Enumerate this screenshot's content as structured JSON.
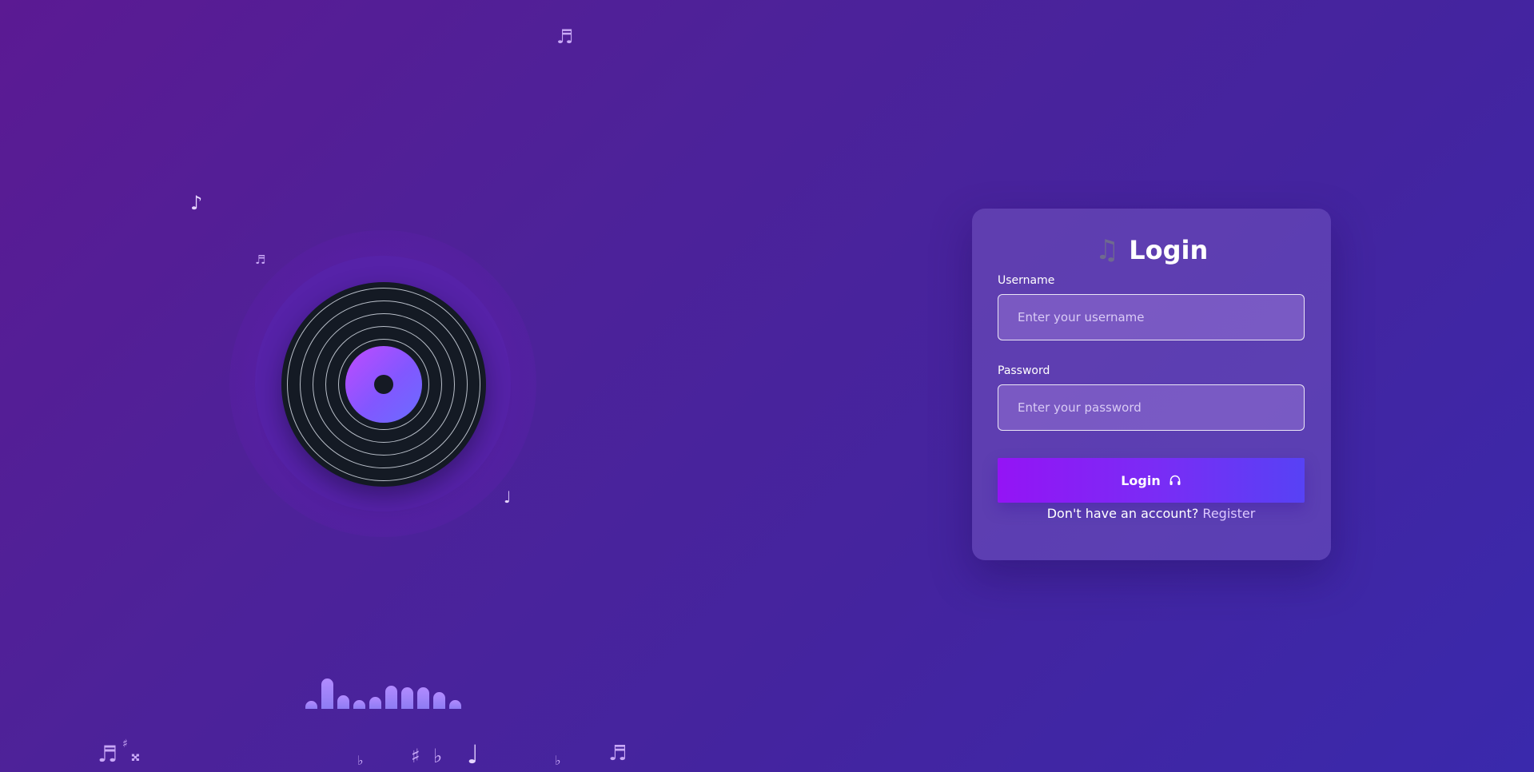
{
  "background": {
    "gradient_start": "#5b1a93",
    "gradient_end": "#3a29ac",
    "floating_notes": [
      "♬",
      "♪",
      "♬",
      "♩"
    ],
    "bottom_notes": [
      "♬",
      "♯",
      "𝄪",
      "♭",
      "♯",
      "♭",
      "♩",
      "♭",
      "♬"
    ]
  },
  "vinyl": {
    "label_color_start": "#c04bff",
    "label_color_end": "#6a6dff",
    "disc_color": "#141a24"
  },
  "equalizer": {
    "levels": [
      0.25,
      1.0,
      0.45,
      0.3,
      0.4,
      0.75,
      0.72,
      0.7,
      0.55,
      0.28
    ]
  },
  "login_card": {
    "title": "Login",
    "title_icon": "music-notes-icon",
    "username": {
      "label": "Username",
      "placeholder": "Enter your username",
      "value": ""
    },
    "password": {
      "label": "Password",
      "placeholder": "Enter your password",
      "value": ""
    },
    "submit": {
      "label": "Login",
      "icon": "headphones-icon",
      "gradient_start": "#9414f5",
      "gradient_end": "#5742f5"
    },
    "register_prompt": "Don't have an account?",
    "register_link": "Register"
  }
}
